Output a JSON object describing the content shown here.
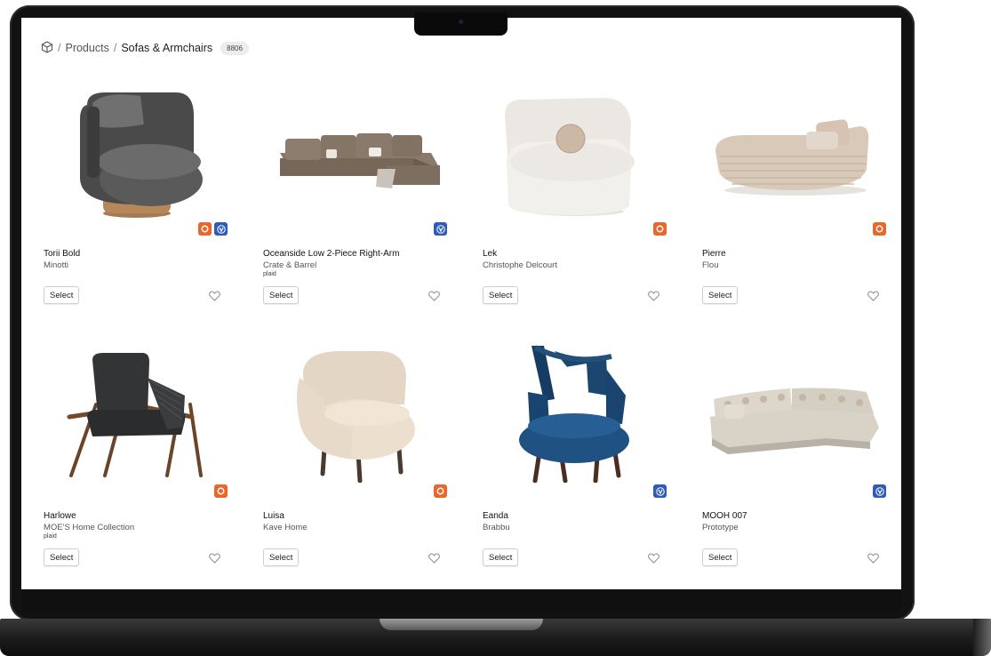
{
  "breadcrumb": {
    "products": "Products",
    "category": "Sofas & Armchairs",
    "count": "8806",
    "separator": "/"
  },
  "products": [
    {
      "name": "Torii Bold",
      "brand": "Minotti",
      "tag": "",
      "badges": [
        "corona",
        "vray"
      ],
      "thumb": "armchair-grey-swivel"
    },
    {
      "name": "Oceanside Low 2-Piece Right-Arm",
      "brand": "Crate & Barrel",
      "tag": "plaid",
      "badges": [
        "vray"
      ],
      "thumb": "sofa-sectional-brown"
    },
    {
      "name": "Lek",
      "brand": "Christophe Delcourt",
      "tag": "",
      "badges": [
        "corona"
      ],
      "thumb": "armchair-white-round"
    },
    {
      "name": "Pierre",
      "brand": "Flou",
      "tag": "",
      "badges": [
        "corona"
      ],
      "thumb": "daybed-beige"
    },
    {
      "name": "Harlowe",
      "brand": "MOE'S Home Collection",
      "tag": "plaid",
      "badges": [
        "corona"
      ],
      "thumb": "lounge-chair-leather"
    },
    {
      "name": "Luisa",
      "brand": "Kave Home",
      "tag": "",
      "badges": [
        "corona"
      ],
      "thumb": "armchair-boucle"
    },
    {
      "name": "Eanda",
      "brand": "Brabbu",
      "tag": "",
      "badges": [
        "vray"
      ],
      "thumb": "armchair-blue-velvet"
    },
    {
      "name": "MOOH 007",
      "brand": "Prototype",
      "tag": "",
      "badges": [
        "vray"
      ],
      "thumb": "corner-sofa-floral"
    }
  ],
  "ui": {
    "select_label": "Select"
  },
  "colors": {
    "corona_badge": "#e8672a",
    "vray_badge": "#2e5db8"
  }
}
